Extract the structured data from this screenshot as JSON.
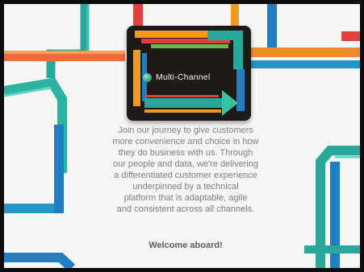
{
  "card": {
    "brand_name": "Multi-Channel",
    "logo_icon": "circle-logo-icon",
    "arrow_icon": "arrow-right-icon"
  },
  "message": {
    "lines": [
      "Join our journey to give customers",
      "more convenience and choice in how",
      "they do business with us. Through",
      "our people and data, we're delivering",
      "a differentiated customer experience",
      "underpinned by a technical",
      "platform that is adaptable, agile",
      "and consistent across all channels."
    ],
    "welcome": "Welcome aboard!"
  },
  "colors": {
    "teal": "#2aa79b",
    "blue": "#1f7fc2",
    "orange": "#f39a1e",
    "red": "#e2403c",
    "green": "#6dbb45",
    "card_bg": "#1d1a17"
  }
}
